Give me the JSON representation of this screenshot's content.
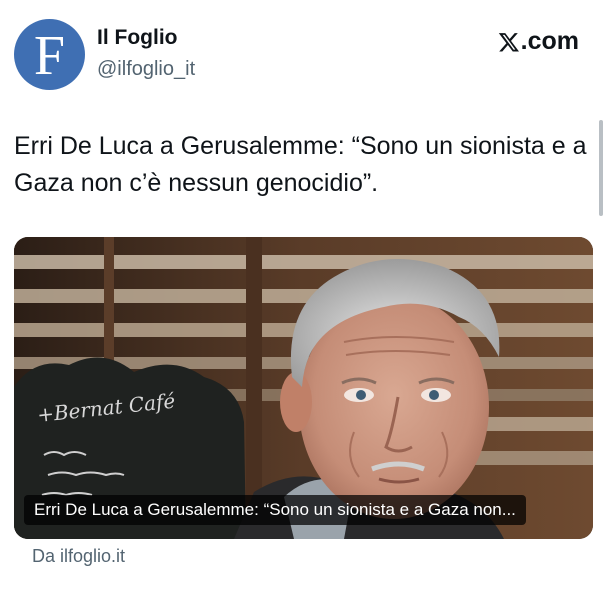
{
  "author": {
    "name": "Il Foglio",
    "handle": "@ilfoglio_it",
    "avatar_letter": "F",
    "avatar_color": "#3f6fb3"
  },
  "platform": {
    "label": ".com",
    "icon": "x-logo-icon"
  },
  "tweet": {
    "text": "Erri De Luca a Gerusalemme: “Sono un sionista e a Gaza non c’è nessun genocidio”."
  },
  "card": {
    "caption": "Erri De Luca a Gerusalemme: “Sono un sionista e a Gaza non...",
    "chalkboard_line1": "+Bernat Café",
    "source": "Da ilfoglio.it"
  }
}
